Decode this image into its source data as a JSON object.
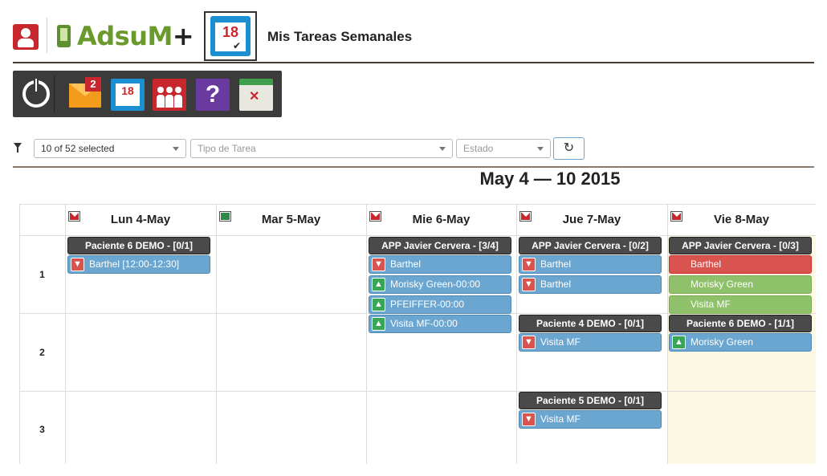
{
  "header": {
    "brand_main": "AdsuM",
    "brand_plus": "+",
    "calendar_number": "18",
    "page_title": "Mis Tareas Semanales"
  },
  "toolbar": {
    "mail_badge": "2",
    "calendar_number": "18",
    "help_label": "?"
  },
  "filters": {
    "patients_value": "10 of 52 selected",
    "task_type_placeholder": "Tipo de Tarea",
    "status_placeholder": "Estado",
    "refresh_label": "↻"
  },
  "calendar": {
    "title": "May 4 — 10 2015",
    "days": [
      {
        "label": "Lun 4-May",
        "icon": "mail-icon"
      },
      {
        "label": "Mar 5-May",
        "icon": "ok-icon"
      },
      {
        "label": "Mie 6-May",
        "icon": "mail-icon"
      },
      {
        "label": "Jue 7-May",
        "icon": "mail-icon"
      },
      {
        "label": "Vie 8-May",
        "icon": "mail-icon"
      }
    ],
    "rows": [
      "1",
      "2",
      "3"
    ],
    "groups": {
      "mon_1": "Paciente 6 DEMO - [0/1]",
      "wed_1": "APP Javier Cervera - [3/4]",
      "thu_1": "APP Javier Cervera - [0/2]",
      "thu_2": "Paciente 4 DEMO - [0/1]",
      "thu_3": "Paciente 5 DEMO - [0/1]",
      "fri_1": "APP Javier Cervera - [0/3]",
      "fri_2": "Paciente 6 DEMO - [1/1]"
    },
    "tasks": {
      "mon_1_a": "Barthel [12:00-12:30]",
      "wed_1_a": "Barthel",
      "wed_1_b": "Morisky Green-00:00",
      "wed_1_c": "PFEIFFER-00:00",
      "wed_1_d": "Visita MF-00:00",
      "thu_1_a": "Barthel",
      "thu_1_b": "Barthel",
      "thu_2_a": "Visita MF",
      "thu_3_a": "Visita MF",
      "fri_1_a": "Barthel",
      "fri_1_b": "Morisky Green",
      "fri_1_c": "Visita MF",
      "fri_2_a": "Morisky Green"
    }
  },
  "colors": {
    "task_blue": "#6aa6cf",
    "task_red": "#d9534f",
    "task_green": "#8fc06a",
    "group_dark": "#4a4a4a",
    "today_bg": "#fcf8e3"
  }
}
